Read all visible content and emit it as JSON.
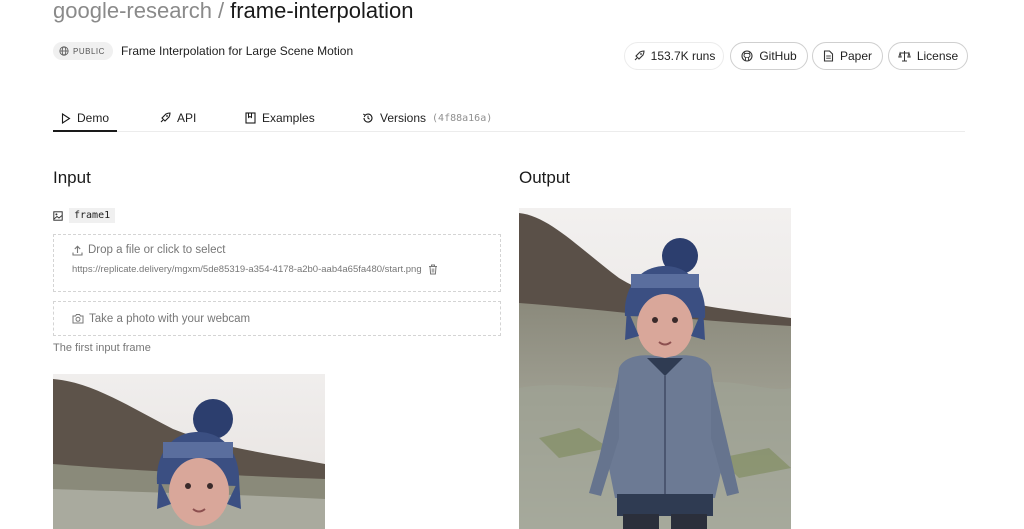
{
  "repo": {
    "owner": "google-research",
    "separator": "/",
    "name": "frame-interpolation",
    "visibility": "PUBLIC",
    "description": "Frame Interpolation for Large Scene Motion"
  },
  "actions": {
    "runs": "153.7K runs",
    "github": "GitHub",
    "paper": "Paper",
    "license": "License"
  },
  "tabs": [
    {
      "label": "Demo",
      "icon": "play-icon",
      "active": true
    },
    {
      "label": "API",
      "icon": "rocket-icon",
      "active": false
    },
    {
      "label": "Examples",
      "icon": "bookmark-icon",
      "active": false
    },
    {
      "label": "Versions",
      "icon": "history-icon",
      "hash": "(4f88a16a)",
      "active": false
    }
  ],
  "input": {
    "title": "Input",
    "field_name": "frame1",
    "drop_label": "Drop a file or click to select",
    "file_url": "https://replicate.delivery/mgxm/5de85319-a354-4178-a2b0-aab4a65fa480/start.png",
    "webcam_label": "Take a photo with your webcam",
    "hint": "The first input frame"
  },
  "output": {
    "title": "Output"
  },
  "colors": {
    "text": "#1a1a1a",
    "muted": "#777777",
    "border": "#cfcfcf"
  }
}
